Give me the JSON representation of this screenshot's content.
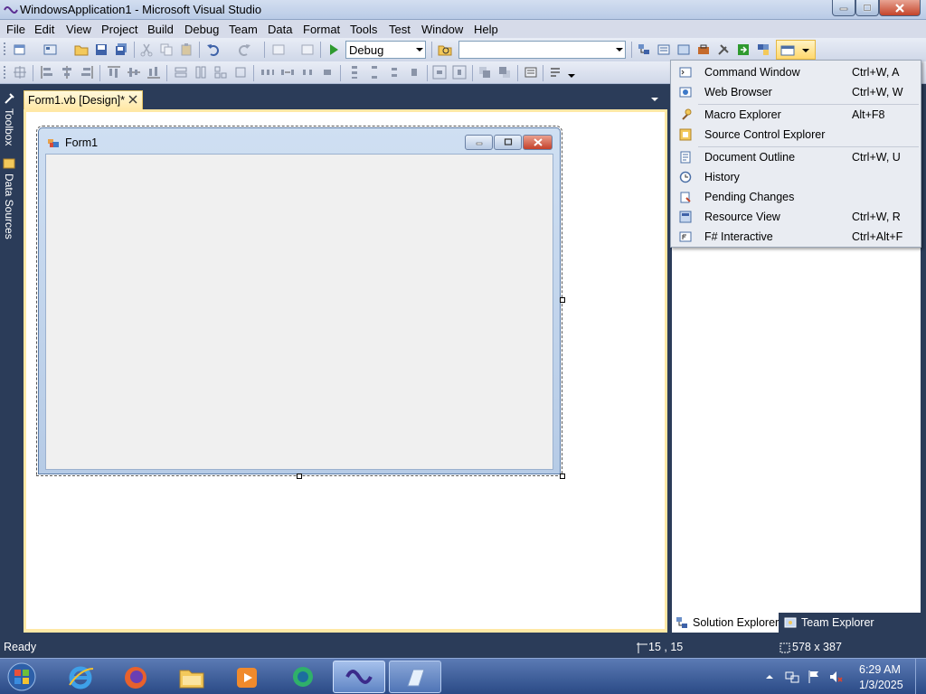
{
  "window": {
    "title": "WindowsApplication1 - Microsoft Visual Studio"
  },
  "menubar": {
    "items": [
      "File",
      "Edit",
      "View",
      "Project",
      "Build",
      "Debug",
      "Team",
      "Data",
      "Format",
      "Tools",
      "Test",
      "Window",
      "Help"
    ]
  },
  "toolbar": {
    "solution_config": "Debug",
    "find_box_value": ""
  },
  "side_tabs": {
    "toolbox": "Toolbox",
    "data_sources": "Data Sources"
  },
  "document_tab": {
    "label": "Form1.vb [Design]*"
  },
  "form1": {
    "title": "Form1"
  },
  "windows_menu": {
    "items": [
      {
        "label": "Command Window",
        "shortcut": "Ctrl+W, A",
        "icon": "command-window-icon"
      },
      {
        "label": "Web Browser",
        "shortcut": "Ctrl+W, W",
        "icon": "web-browser-icon"
      },
      {
        "label": "Macro Explorer",
        "shortcut": "Alt+F8",
        "icon": "macro-explorer-icon"
      },
      {
        "label": "Source Control Explorer",
        "shortcut": "",
        "icon": "source-control-icon"
      },
      {
        "label": "Document Outline",
        "shortcut": "Ctrl+W, U",
        "icon": "document-outline-icon"
      },
      {
        "label": "History",
        "shortcut": "",
        "icon": "history-icon"
      },
      {
        "label": "Pending Changes",
        "shortcut": "",
        "icon": "pending-changes-icon"
      },
      {
        "label": "Resource View",
        "shortcut": "Ctrl+W, R",
        "icon": "resource-view-icon"
      },
      {
        "label": "F# Interactive",
        "shortcut": "Ctrl+Alt+F",
        "icon": "fsharp-interactive-icon"
      }
    ]
  },
  "bottom_tabs": {
    "solution_explorer": "Solution Explorer",
    "team_explorer": "Team Explorer"
  },
  "statusbar": {
    "status": "Ready",
    "position": "15 , 15",
    "size": "578 x 387"
  },
  "taskbar": {
    "time": "6:29 AM",
    "date": "1/3/2025"
  },
  "colors": {
    "ide_background": "#2b3c59",
    "document_tab": "#ffe8a6",
    "menu_background": "#e9ecf2"
  }
}
